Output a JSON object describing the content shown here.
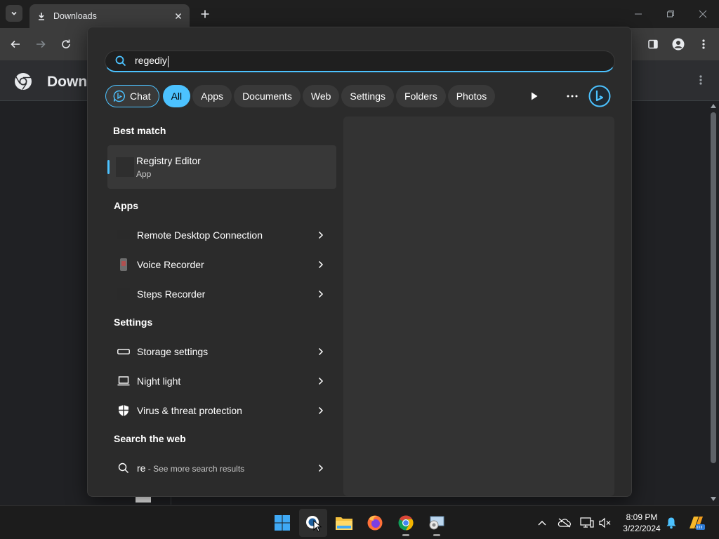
{
  "browser": {
    "tab_title": "Downloads",
    "page_title": "Down"
  },
  "search": {
    "query": "regediy"
  },
  "filters": {
    "chat": "Chat",
    "all": "All",
    "apps": "Apps",
    "documents": "Documents",
    "web": "Web",
    "settings": "Settings",
    "folders": "Folders",
    "photos": "Photos"
  },
  "best_match": {
    "header": "Best match",
    "name": "Registry Editor",
    "type": "App"
  },
  "apps": {
    "header": "Apps",
    "items": [
      "Remote Desktop Connection",
      "Voice Recorder",
      "Steps Recorder"
    ]
  },
  "settings": {
    "header": "Settings",
    "items": [
      "Storage settings",
      "Night light",
      "Virus & threat protection"
    ]
  },
  "web": {
    "header": "Search the web",
    "query": "re",
    "suffix": " - See more search results"
  },
  "clock": {
    "time": "8:09 PM",
    "date": "3/22/2024"
  },
  "colors": {
    "accent": "#4cc2ff",
    "panel": "#2b2b2b"
  }
}
